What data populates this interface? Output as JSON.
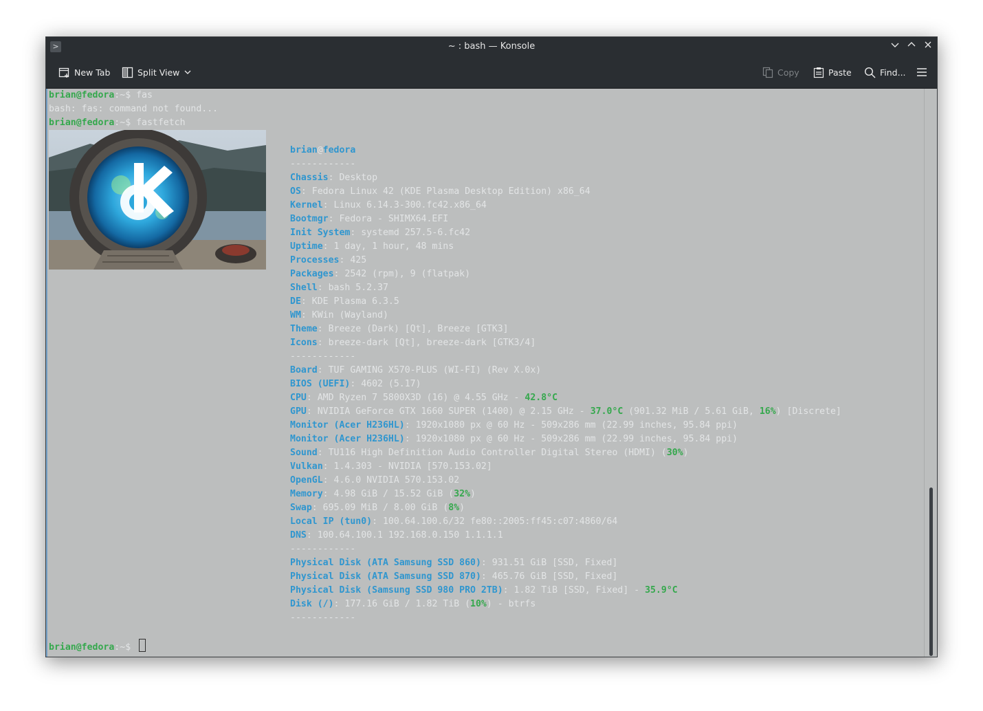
{
  "window": {
    "title": "~ : bash — Konsole",
    "app_icon": "terminal-icon",
    "controls": [
      "minimize-chevron-icon",
      "maximize-chevron-icon",
      "close-icon"
    ]
  },
  "toolbar": {
    "new_tab": "New Tab",
    "split_view": "Split View",
    "copy": "Copy",
    "paste": "Paste",
    "find": "Find...",
    "menu_icon": "hamburger-icon"
  },
  "terminal": {
    "user": "brian@fedora",
    "prompt_sep": ":",
    "prompt_path": "~",
    "prompt_sym": "$ ",
    "cmd1": "fas",
    "error1": "bash: fas: command not found...",
    "cmd2": "fastfetch",
    "ff_user": "brian",
    "ff_at": "@",
    "ff_host": "fedora",
    "separator": "------------",
    "lines": [
      {
        "k": "Chassis",
        "v": ": Desktop"
      },
      {
        "k": "OS",
        "v": ": Fedora Linux 42 (KDE Plasma Desktop Edition) x86_64"
      },
      {
        "k": "Kernel",
        "v": ": Linux 6.14.3-300.fc42.x86_64"
      },
      {
        "k": "Bootmgr",
        "v": ": Fedora - SHIMX64.EFI"
      },
      {
        "k": "Init System",
        "v": ": systemd 257.5-6.fc42"
      },
      {
        "k": "Uptime",
        "v": ": 1 day, 1 hour, 48 mins"
      },
      {
        "k": "Processes",
        "v": ": 425"
      },
      {
        "k": "Packages",
        "v": ": 2542 (rpm), 9 (flatpak)"
      },
      {
        "k": "Shell",
        "v": ": bash 5.2.37"
      },
      {
        "k": "DE",
        "v": ": KDE Plasma 6.3.5"
      },
      {
        "k": "WM",
        "v": ": KWin (Wayland)"
      },
      {
        "k": "Theme",
        "v": ": Breeze (Dark) [Qt], Breeze [GTK3]"
      },
      {
        "k": "Icons",
        "v": ": breeze-dark [Qt], breeze-dark [GTK3/4]"
      }
    ],
    "hw": {
      "board_k": "Board",
      "board_v": ": TUF GAMING X570-PLUS (WI-FI) (Rev X.0x)",
      "bios_k": "BIOS (UEFI)",
      "bios_v": ": 4602 (5.17)",
      "cpu_k": "CPU",
      "cpu_v": ": AMD Ryzen 7 5800X3D (16) @ 4.55 GHz - ",
      "cpu_t": "42.8°C",
      "gpu_k": "GPU",
      "gpu_v": ": NVIDIA GeForce GTX 1660 SUPER (1400) @ 2.15 GHz - ",
      "gpu_t": "37.0°C",
      "gpu_v2": " (901.32 MiB / 5.61 GiB, ",
      "gpu_p": "16%",
      "gpu_v3": ") [Discrete]",
      "mon1_k": "Monitor (Acer H236HL)",
      "mon1_v": ": 1920x1080 px @ 60 Hz - 509x286 mm (22.99 inches, 95.84 ppi)",
      "mon2_k": "Monitor (Acer H236HL)",
      "mon2_v": ": 1920x1080 px @ 60 Hz - 509x286 mm (22.99 inches, 95.84 ppi)",
      "sound_k": "Sound",
      "sound_v": ": TU116 High Definition Audio Controller Digital Stereo (HDMI) (",
      "sound_p": "30%",
      "sound_v2": ")",
      "vulkan_k": "Vulkan",
      "vulkan_v": ": 1.4.303 - NVIDIA [570.153.02]",
      "opengl_k": "OpenGL",
      "opengl_v": ": 4.6.0 NVIDIA 570.153.02",
      "mem_k": "Memory",
      "mem_v": ": 4.98 GiB / 15.52 GiB (",
      "mem_p": "32%",
      "mem_v2": ")",
      "swap_k": "Swap",
      "swap_v": ": 695.09 MiB / 8.00 GiB (",
      "swap_p": "8%",
      "swap_v2": ")",
      "ip_k": "Local IP (tun0)",
      "ip_v": ": 100.64.100.6/32 fe80::2005:ff45:c07:4860/64",
      "dns_k": "DNS",
      "dns_v": ": 100.64.100.1 192.168.0.150 1.1.1.1"
    },
    "disks": {
      "d1_k": "Physical Disk (ATA Samsung SSD 860)",
      "d1_v": ": 931.51 GiB [SSD, Fixed]",
      "d2_k": "Physical Disk (ATA Samsung SSD 870)",
      "d2_v": ": 465.76 GiB [SSD, Fixed]",
      "d3_k": "Physical Disk (Samsung SSD 980 PRO 2TB)",
      "d3_v": ": 1.82 TiB [SSD, Fixed] - ",
      "d3_t": "35.9°C",
      "d4_k": "Disk (/)",
      "d4_v": ": 177.16 GiB / 1.82 TiB (",
      "d4_p": "10%",
      "d4_v2": ") - btrfs"
    }
  }
}
